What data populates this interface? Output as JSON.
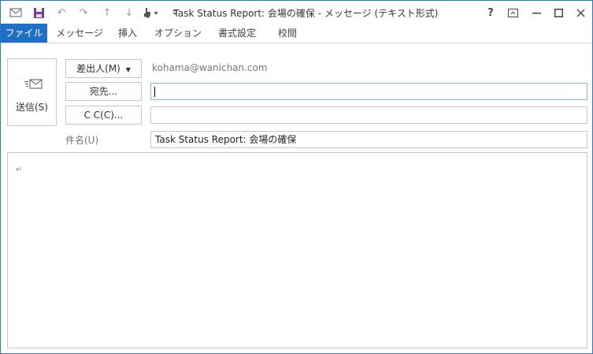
{
  "titlebar": {
    "title": "Task Status Report: 会場の確保 - メッセージ (テキスト形式)",
    "qat_icons": [
      "outlook-icon",
      "save-icon",
      "undo-icon",
      "redo-icon",
      "up-arrow-icon",
      "down-arrow-icon",
      "touch-mode-icon",
      "customize-qat-icon"
    ],
    "window_buttons": {
      "help": "?",
      "restore_ribbon": "ribbon-display-icon",
      "minimize": "minimize-icon",
      "maximize": "maximize-icon",
      "close": "close-icon"
    }
  },
  "ribbon": {
    "tabs": [
      {
        "label": "ファイル"
      },
      {
        "label": "メッセージ"
      },
      {
        "label": "挿入"
      },
      {
        "label": "オプション"
      },
      {
        "label": "書式設定"
      },
      {
        "label": "校閲"
      }
    ]
  },
  "compose": {
    "send_label": "送信(S)",
    "from_button": "差出人(M)",
    "from_value": "kohama@wanichan.com",
    "to_button": "宛先...",
    "to_value": "",
    "cc_button": "C C(C)...",
    "cc_value": "",
    "subject_label": "件名(U)",
    "subject_value": "Task Status Report: 会場の確保",
    "body_mark": "↵"
  },
  "colors": {
    "accent": "#1f6fc5",
    "window_border": "#2b78c9",
    "qat_save": "#7a3e9d"
  }
}
